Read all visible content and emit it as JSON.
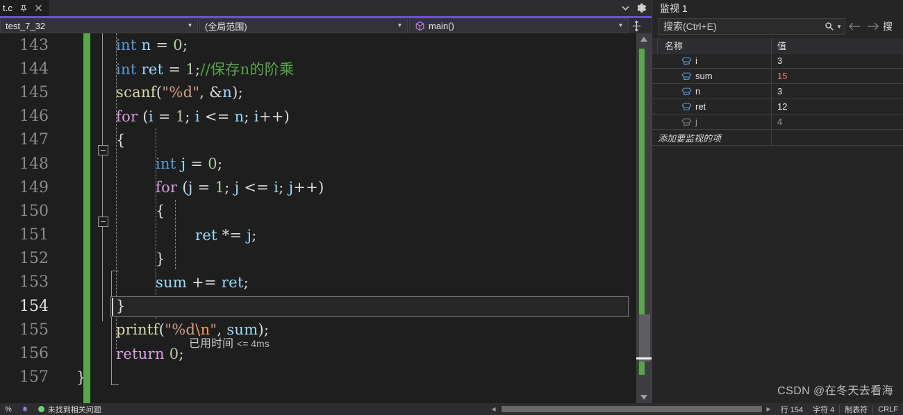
{
  "window": {
    "accent_color": "#6a4fd8",
    "editor_bg": "#1e1e1e",
    "panel_bg": "#252526"
  },
  "tab_strip": {
    "tabs": [
      {
        "label": "t.c",
        "pin_icon": "pin-icon",
        "close_icon": "close-icon"
      }
    ],
    "overflow_icon": "chevron-down-icon",
    "settings_icon": "gear-icon"
  },
  "nav_bar": {
    "project": {
      "label": "test_7_32",
      "caret": "▼"
    },
    "scope": {
      "label": "(全局范围)",
      "caret": "▼"
    },
    "member": {
      "label": "main()",
      "icon": "cube-icon",
      "caret": "▼"
    },
    "split_icon": "split-view-icon"
  },
  "code": {
    "first_line_number": 143,
    "current_line": 154,
    "elapsed_tip": {
      "label": "已用时间",
      "value": "<= 4ms"
    },
    "lines": [
      {
        "n": 143,
        "indent": 0
      },
      {
        "n": 144,
        "indent": 0
      },
      {
        "n": 145,
        "indent": 0
      },
      {
        "n": 146,
        "indent": 0
      },
      {
        "n": 147,
        "indent": 0
      },
      {
        "n": 148,
        "indent": 0
      },
      {
        "n": 149,
        "indent": 0
      },
      {
        "n": 150,
        "indent": 0
      },
      {
        "n": 151,
        "indent": 0
      },
      {
        "n": 152,
        "indent": 0
      },
      {
        "n": 153,
        "indent": 0
      },
      {
        "n": 154,
        "indent": 0
      },
      {
        "n": 155,
        "indent": 0
      },
      {
        "n": 156,
        "indent": 0
      },
      {
        "n": 157,
        "indent": 0
      }
    ],
    "text": {
      "l143": "int n = 0;",
      "l144": "int ret = 1;//保存n的阶乘",
      "l145": "scanf(\"%d\", &n);",
      "l146": "for (i = 1; i <= n; i++)",
      "l147": "{",
      "l148": "int j = 0;",
      "l149": "for (j = 1; j <= i; j++)",
      "l150": "{",
      "l151": "ret *= j;",
      "l152": "}",
      "l153": "sum += ret;",
      "l154": "}",
      "l155": "printf(\"%d\\n\", sum);",
      "l156": "return 0;",
      "l157": "}"
    },
    "tokens": {
      "kw_int": "int",
      "kw_for": "for",
      "kw_return": "return",
      "fn_scanf": "scanf",
      "fn_printf": "printf",
      "var_n": "n",
      "var_ret": "ret",
      "var_i": "i",
      "var_j": "j",
      "var_sum": "sum",
      "num_0": "0",
      "num_1": "1",
      "comment_144": "//保存n的阶乘",
      "str_pct_d": "\"%d\"",
      "str_pct_dn_open": "\"%d",
      "str_escape_n": "\\n",
      "str_close": "\""
    },
    "colors": {
      "keyword_type": "#569cd6",
      "keyword_control": "#d8a0df",
      "function": "#dcdcaa",
      "identifier": "#9cdcfe",
      "number": "#b5cea8",
      "string": "#d69d85",
      "escape": "#ff9d4b",
      "comment": "#57a64a",
      "change_bar": "#57a64a"
    }
  },
  "scrollbar": {
    "up_arrow": "▲",
    "down_arrow": "▼"
  },
  "watch_panel": {
    "title": "监视 1",
    "search": {
      "placeholder": "搜索(Ctrl+E)",
      "icon": "search-icon",
      "caret": "▼"
    },
    "prev_icon": "arrow-left-icon",
    "next_icon": "arrow-right-icon",
    "depth_label": "搜",
    "columns": [
      "名称",
      "值"
    ],
    "rows": [
      {
        "name": "i",
        "value": "3",
        "changed": false,
        "dim": false
      },
      {
        "name": "sum",
        "value": "15",
        "changed": true,
        "dim": false
      },
      {
        "name": "n",
        "value": "3",
        "changed": false,
        "dim": false
      },
      {
        "name": "ret",
        "value": "12",
        "changed": false,
        "dim": false
      },
      {
        "name": "j",
        "value": "4",
        "changed": false,
        "dim": true
      }
    ],
    "add_row_placeholder": "添加要监视的项"
  },
  "status_bar": {
    "issue_text": "未找到相关问题",
    "line": "行 154",
    "column": "字符 4",
    "indent_mode": "制表符",
    "line_endings": "CRLF"
  },
  "watermark": "CSDN @在冬天去看海"
}
